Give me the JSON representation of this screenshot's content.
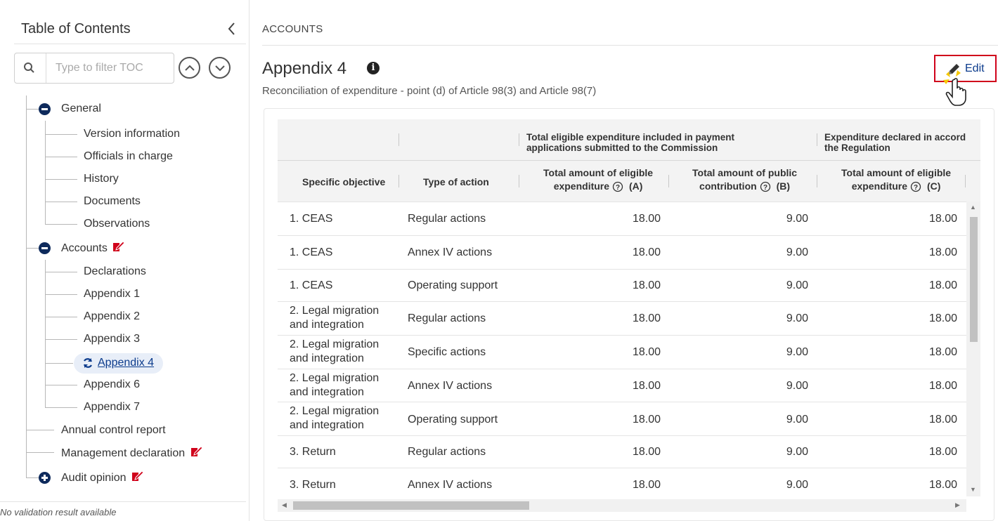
{
  "sidebar": {
    "title": "Table of Contents",
    "collapse_icon": "chevron-left-icon",
    "search_placeholder": "Type to filter TOC",
    "search_value": "",
    "tree": [
      {
        "label": "General",
        "expanded": true,
        "children": [
          "Version information",
          "Officials in charge",
          "History",
          "Documents",
          "Observations"
        ]
      },
      {
        "label": "Accounts",
        "expanded": true,
        "flag": "edit-flag-icon",
        "children": [
          "Declarations",
          "Appendix 1",
          "Appendix 2",
          "Appendix 3",
          "Appendix 4",
          "Appendix 6",
          "Appendix 7"
        ]
      },
      {
        "label": "Annual control report"
      },
      {
        "label": "Management declaration",
        "flag": "edit-flag-icon"
      },
      {
        "label": "Audit opinion",
        "expanded": false,
        "flag": "edit-flag-icon"
      }
    ],
    "active_item": "Appendix 4",
    "footer_note": "No validation result available"
  },
  "main": {
    "breadcrumb": "ACCOUNTS",
    "title": "Appendix 4",
    "subtitle": "Reconciliation of expenditure - point (d) of Article 98(3) and Article 98(7)",
    "edit_label": "Edit",
    "table": {
      "group_header_1": "Total eligible expenditure included in payment applications submitted to the Commission",
      "group_header_1_line1": "Total eligible expenditure included in payment",
      "group_header_1_line2": "applications submitted to the Commission",
      "group_header_2_line1": "Expenditure declared in accord",
      "group_header_2_line2": "the Regulation",
      "columns": [
        {
          "label": "Specific objective"
        },
        {
          "label": "Type of action"
        },
        {
          "line1": "Total amount of eligible",
          "line2": "expenditure",
          "code": "(A)"
        },
        {
          "line1": "Total amount of public",
          "line2": "contribution",
          "code": "(B)"
        },
        {
          "line1": "Total amount of eligible",
          "line2": "expenditure",
          "code": "(C)"
        }
      ],
      "rows": [
        {
          "objective": [
            "1. CEAS"
          ],
          "action": "Regular actions",
          "a": "18.00",
          "b": "9.00",
          "c": "18.00"
        },
        {
          "objective": [
            "1. CEAS"
          ],
          "action": "Annex IV actions",
          "a": "18.00",
          "b": "9.00",
          "c": "18.00"
        },
        {
          "objective": [
            "1. CEAS"
          ],
          "action": "Operating support",
          "a": "18.00",
          "b": "9.00",
          "c": "18.00"
        },
        {
          "objective": [
            "2. Legal migration",
            "and integration"
          ],
          "action": "Regular actions",
          "a": "18.00",
          "b": "9.00",
          "c": "18.00"
        },
        {
          "objective": [
            "2. Legal migration",
            "and integration"
          ],
          "action": "Specific actions",
          "a": "18.00",
          "b": "9.00",
          "c": "18.00"
        },
        {
          "objective": [
            "2. Legal migration",
            "and integration"
          ],
          "action": "Annex IV actions",
          "a": "18.00",
          "b": "9.00",
          "c": "18.00"
        },
        {
          "objective": [
            "2. Legal migration",
            "and integration"
          ],
          "action": "Operating support",
          "a": "18.00",
          "b": "9.00",
          "c": "18.00"
        },
        {
          "objective": [
            "3. Return"
          ],
          "action": "Regular actions",
          "a": "18.00",
          "b": "9.00",
          "c": "18.00"
        },
        {
          "objective": [
            "3. Return"
          ],
          "action": "Annex IV actions",
          "a": "18.00",
          "b": "9.00",
          "c": "18.00"
        }
      ]
    }
  },
  "colors": {
    "accent": "#0b3b8c",
    "flag": "#d0021b",
    "tree_icon": "#0e2a5c"
  }
}
